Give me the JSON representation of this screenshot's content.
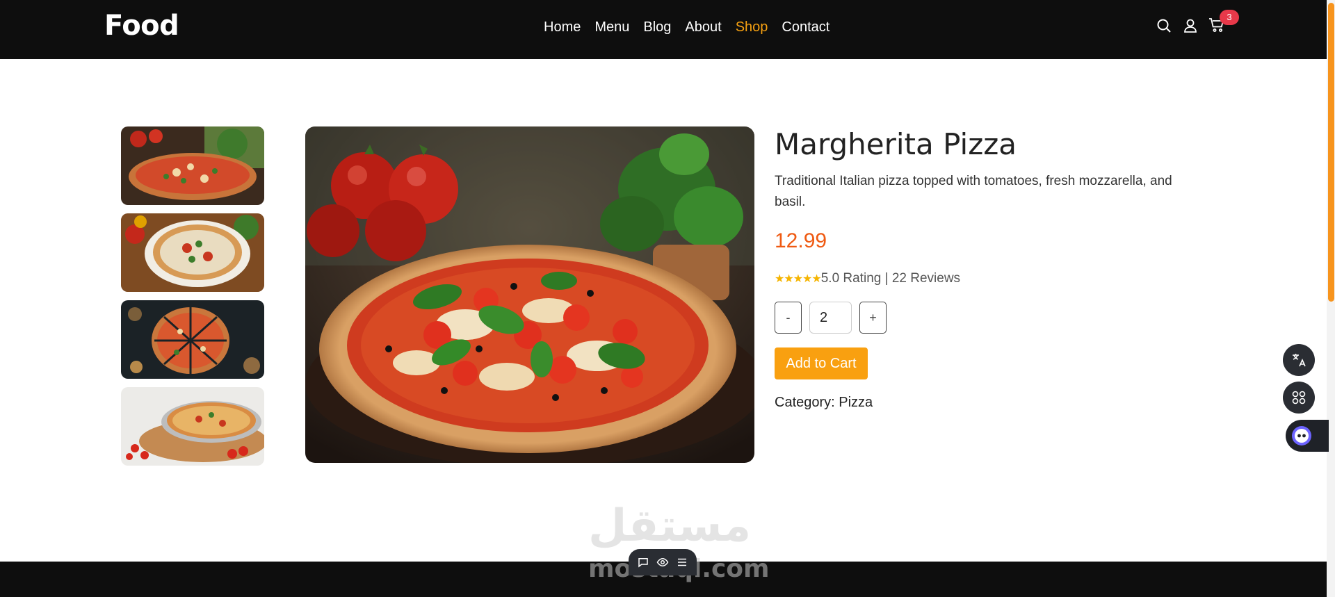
{
  "header": {
    "logo": "Food",
    "nav": [
      {
        "label": "Home",
        "active": false
      },
      {
        "label": "Menu",
        "active": false
      },
      {
        "label": "Blog",
        "active": false
      },
      {
        "label": "About",
        "active": false
      },
      {
        "label": "Shop",
        "active": true
      },
      {
        "label": "Contact",
        "active": false
      }
    ],
    "icons": [
      "search-icon",
      "user-icon",
      "cart-icon"
    ],
    "cart_count": "3"
  },
  "product": {
    "title": "Margherita Pizza",
    "description": "Traditional Italian pizza topped with tomatoes, fresh mozzarella, and basil.",
    "price": "12.99",
    "stars": "★★★★★",
    "rating_text": "5.0 Rating | 22 Reviews",
    "rating_value": 5.0,
    "quantity": {
      "minus": "-",
      "value": "2",
      "plus": "+"
    },
    "add_to_cart": "Add to Cart",
    "category_label": "Category: ",
    "category_value": "Pizza"
  },
  "gallery": {
    "thumbnail_count": 4,
    "main_image": "pizza-with-tomatoes-and-basil"
  },
  "floating": [
    "translate-icon",
    "apps-icon",
    "assistant-icon"
  ],
  "watermark": {
    "arabic": "مستقل",
    "english": "mostaql.com"
  },
  "bottom_toolbar": [
    "chat-icon",
    "eye-icon",
    "menu-icon"
  ],
  "colors": {
    "header_bg": "#0e0e0e",
    "accent": "#f5a011",
    "price": "#ef5a12",
    "button": "#f9a010",
    "badge": "#e8394a",
    "stars": "#f5b400"
  }
}
